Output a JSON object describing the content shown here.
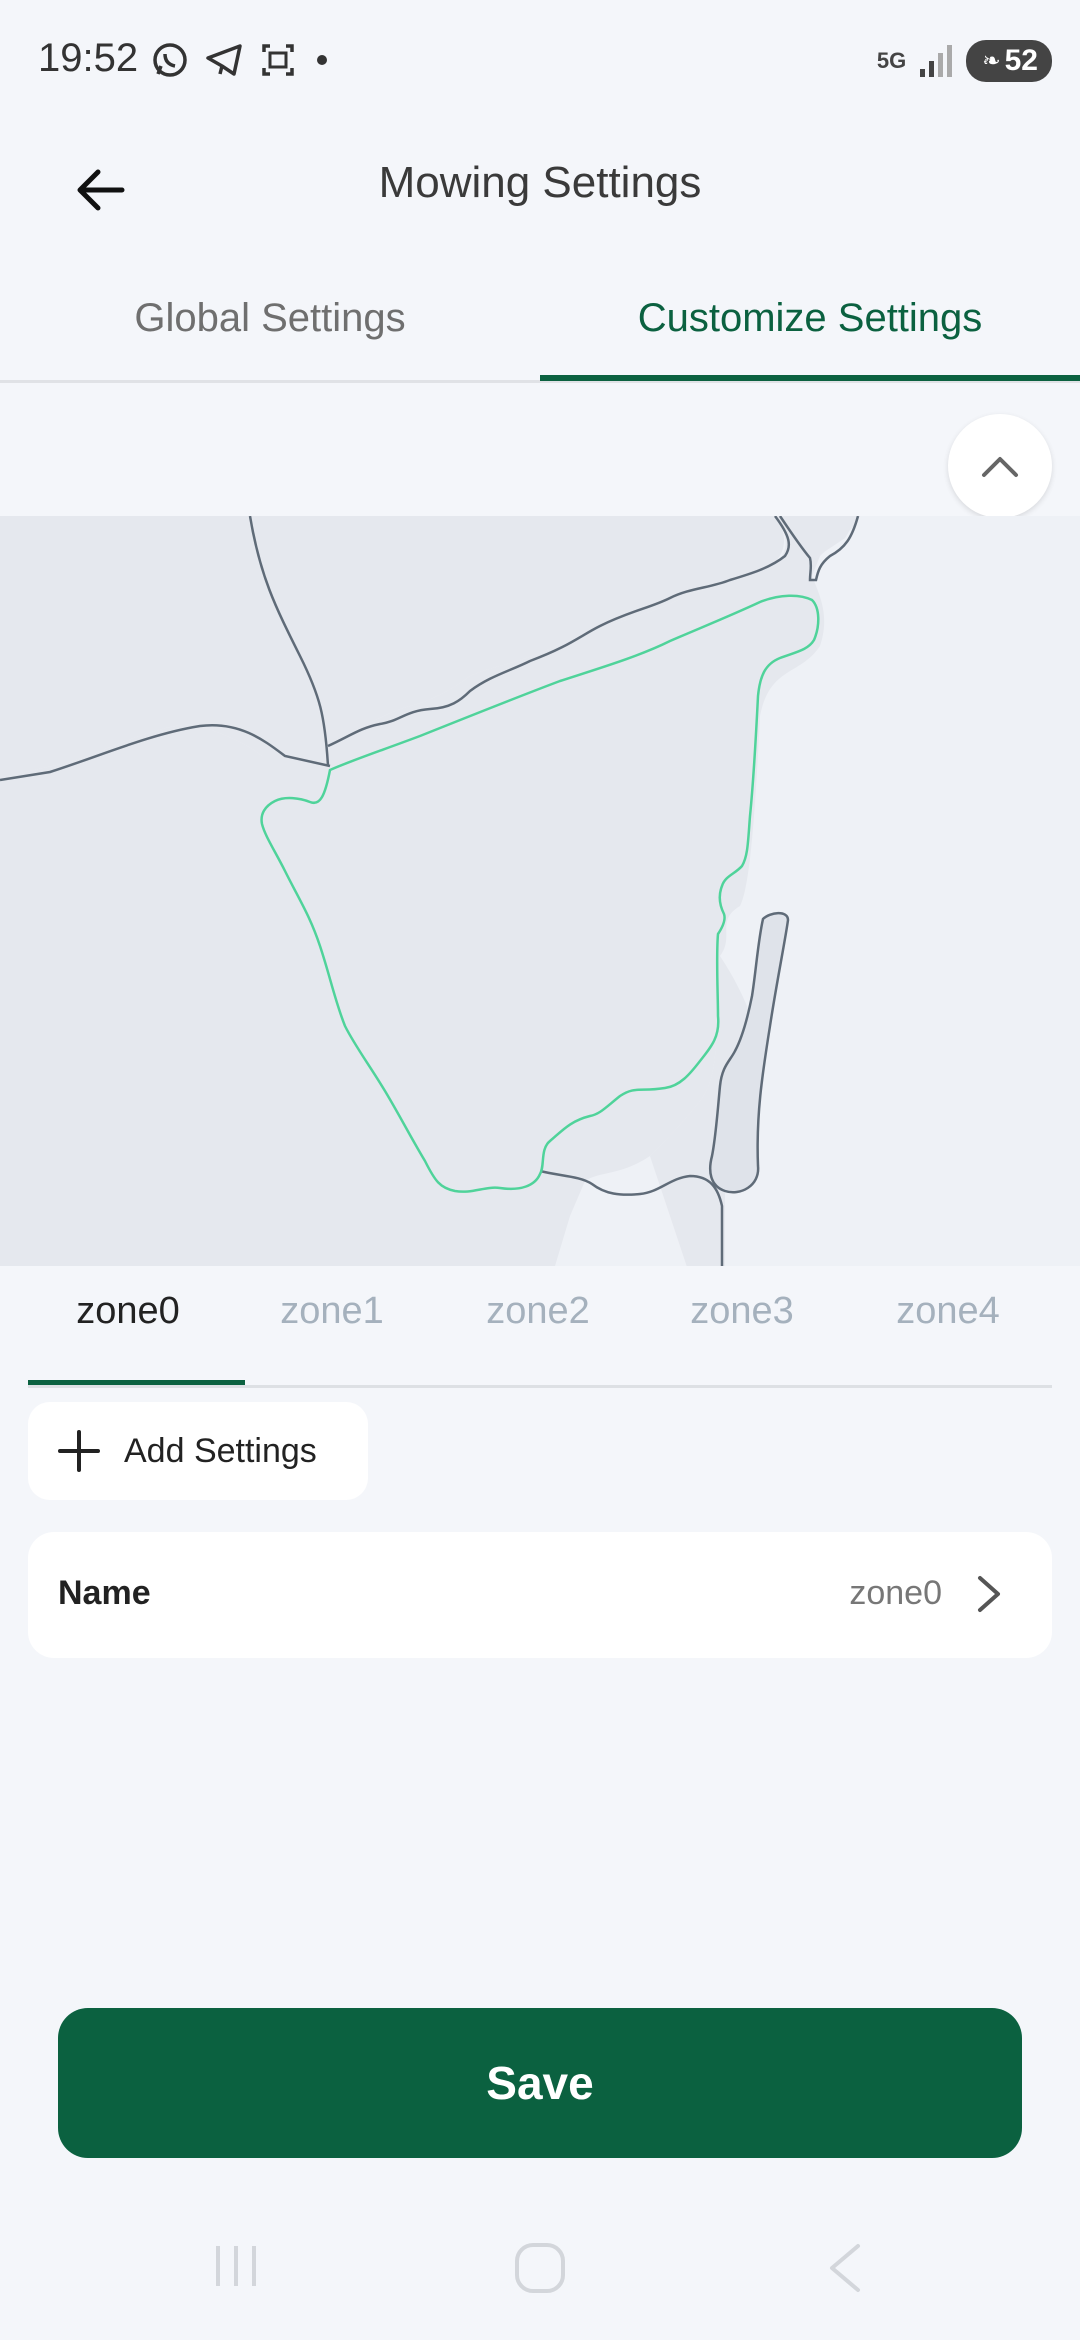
{
  "status_bar": {
    "time": "19:52",
    "network": "5G",
    "battery": "52",
    "icons": [
      "whatsapp-icon",
      "telegram-icon",
      "screenshot-icon",
      "dot-icon"
    ]
  },
  "header": {
    "title": "Mowing Settings"
  },
  "tabs": {
    "global": "Global Settings",
    "customize": "Customize Settings",
    "active": "customize"
  },
  "zones": {
    "items": [
      "zone0",
      "zone1",
      "zone2",
      "zone3",
      "zone4"
    ],
    "active": "zone0"
  },
  "add_settings": {
    "label": "Add Settings"
  },
  "name_row": {
    "label": "Name",
    "value": "zone0"
  },
  "save": {
    "label": "Save"
  },
  "colors": {
    "accent": "#0b6140",
    "zone_outline": "#4fd39a",
    "map_fill": "#e5e8ee"
  }
}
